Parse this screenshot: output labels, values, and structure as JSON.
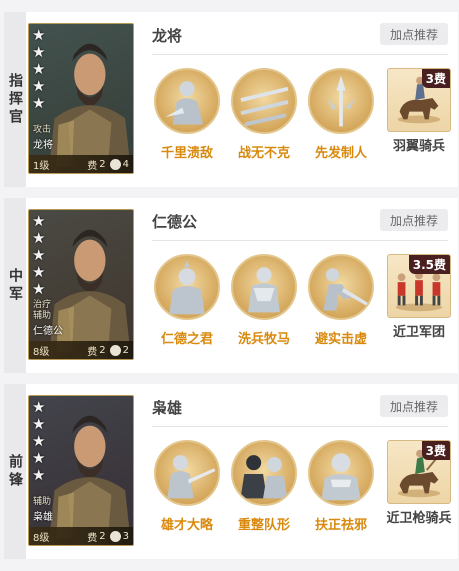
{
  "formation": [
    {
      "position": "指挥官",
      "hero": {
        "name": "龙将",
        "card_name": "龙将",
        "roles": [
          "攻击"
        ],
        "stars": 5,
        "level": "1级",
        "cost_label": "费",
        "cost": "2",
        "unit_count": "4"
      },
      "recommend_label": "加点推荐",
      "skills": [
        {
          "name": "千里溃敌",
          "icon": "mounted-warrior-icon"
        },
        {
          "name": "战无不克",
          "icon": "crossed-blades-icon"
        },
        {
          "name": "先发制人",
          "icon": "spear-strike-icon"
        }
      ],
      "unit": {
        "name": "羽翼骑兵",
        "cost": "3费",
        "icon": "cavalry-icon"
      }
    },
    {
      "position": "中军",
      "hero": {
        "name": "仁德公",
        "card_name": "仁德公",
        "roles": [
          "治疗",
          "辅助"
        ],
        "stars": 5,
        "level": "8级",
        "cost_label": "费",
        "cost": "2",
        "unit_count": "2"
      },
      "recommend_label": "加点推荐",
      "skills": [
        {
          "name": "仁德之君",
          "icon": "lord-icon"
        },
        {
          "name": "洗兵牧马",
          "icon": "armored-soldier-icon"
        },
        {
          "name": "避实击虚",
          "icon": "charging-soldier-icon"
        }
      ],
      "unit": {
        "name": "近卫军团",
        "cost": "3.5费",
        "icon": "guard-troops-icon"
      }
    },
    {
      "position": "前锋",
      "hero": {
        "name": "枭雄",
        "card_name": "枭雄",
        "roles": [
          "辅助"
        ],
        "stars": 5,
        "level": "8级",
        "cost_label": "费",
        "cost": "2",
        "unit_count": "3"
      },
      "recommend_label": "加点推荐",
      "skills": [
        {
          "name": "雄才大略",
          "icon": "sword-wielder-icon"
        },
        {
          "name": "重整队形",
          "icon": "regroup-soldiers-icon"
        },
        {
          "name": "扶正祛邪",
          "icon": "warrior-bust-icon"
        }
      ],
      "unit": {
        "name": "近卫枪骑兵",
        "cost": "3费",
        "icon": "lancer-icon"
      }
    }
  ]
}
